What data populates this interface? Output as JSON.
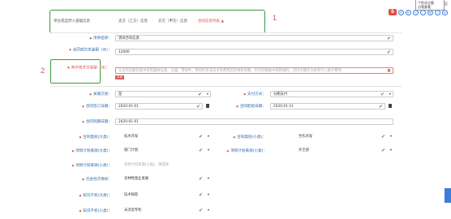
{
  "topbar": {
    "credit": "统一身份认证",
    "tooltip_line1": "个性化主题",
    "tooltip_line2": "点我查看"
  },
  "tabs": [
    {
      "label": "单位或自然人基础信息"
    },
    {
      "label": "卖方（乙方）信息"
    },
    {
      "label": "买方（甲方）信息"
    },
    {
      "label": "合同信息列表"
    }
  ],
  "callouts": {
    "one": "1",
    "two": "2"
  },
  "form": {
    "project_name": {
      "label": "项目名称：",
      "value": "测试合同信息"
    },
    "contract_amount": {
      "label": "合同成交总金额（元）：",
      "value": "12000"
    },
    "tech_transaction": {
      "label": "其中技术交易额（元）：",
      "placeholder": "从合同总额扣减中采购器材设备、仪器、零部件、原材料等非技术性费用后的剩余金额，但合同数据中规则填的，合同全额作为本项计入统计费用",
      "error_badge": "必填"
    },
    "related": {
      "label": "关联交易：",
      "value": "是"
    },
    "payment": {
      "label": "支付方式：",
      "value": "分期支付"
    },
    "sign_date": {
      "label": "合同签订日期：",
      "value": "2020-01-01"
    },
    "start_date": {
      "label": "合同起始日期：",
      "value": "2020-01-11"
    },
    "expire_date": {
      "label": "合同到期日期：",
      "value": "2020-01-01"
    },
    "type_big": {
      "label": "合同类别(大类)：",
      "value": "技术开发"
    },
    "type_small": {
      "label": "合同类别(小类)：",
      "value": "合作开发"
    },
    "plan_big": {
      "label": "项目计划来源(大类)：",
      "value": "部门计划"
    },
    "plan_small": {
      "label": "项目计划来源(小类)：",
      "value": "许全部"
    },
    "plan_detail": {
      "label": "项目计划来源(小类)：",
      "placeholder": "项目计划来源(小类)，请选择"
    },
    "social_goal": {
      "label": "社会经济目标：",
      "value": "农林牧渔业发展"
    },
    "ip_big": {
      "label": "知识产权(大类)：",
      "value": "技术秘密"
    },
    "ip_small": {
      "label": "知识产权(小类)：",
      "value": "未涉及专利"
    }
  },
  "colors": {
    "accent_green": "#3a9a3a",
    "error_red": "#d9534f",
    "label_blue": "#2b6cb0"
  }
}
